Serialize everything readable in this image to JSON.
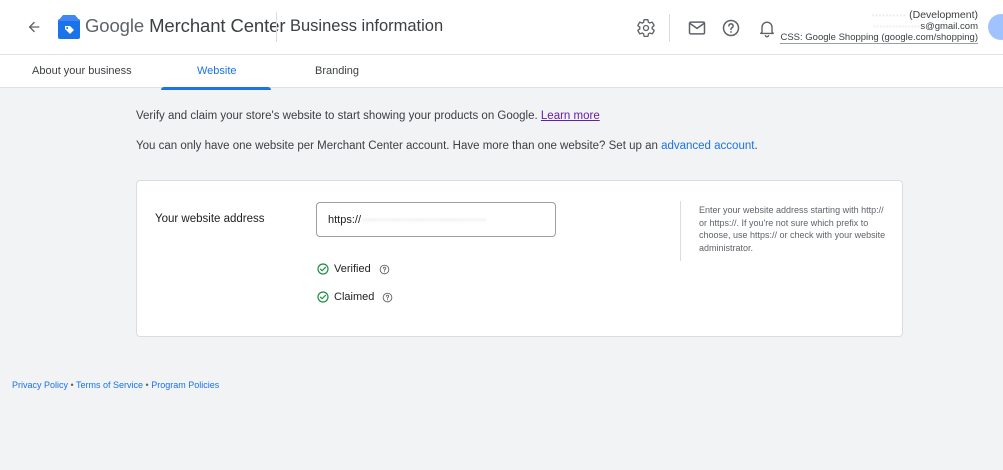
{
  "header": {
    "brand_google": "Google",
    "brand_product": " Merchant Center",
    "page_title": "Business information",
    "account": {
      "name_hidden": "··········",
      "name_suffix": " (Development)",
      "email_hidden": "···············",
      "email_suffix": "s@gmail.com",
      "css": "CSS: Google Shopping (google.com/shopping)"
    },
    "icons": [
      "back-arrow-icon",
      "merchant-center-logo",
      "settings-icon",
      "mail-icon",
      "help-icon",
      "notifications-icon",
      "avatar"
    ]
  },
  "tabs": [
    {
      "label": "About your business",
      "active": false
    },
    {
      "label": "Website",
      "active": true
    },
    {
      "label": "Branding",
      "active": false
    }
  ],
  "intro": {
    "line1": "Verify and claim your store's website to start showing your products on Google.",
    "learn_more": "Learn more",
    "line2": "You can only have one website per Merchant Center account. Have more than one website? Set up an",
    "advanced_link": "advanced account",
    "line2_end": "."
  },
  "website": {
    "label": "Your website address",
    "url_prefix": "https://",
    "url_hidden": "··································",
    "statuses": [
      {
        "label": "Verified",
        "color": "#1e8e3e"
      },
      {
        "label": "Claimed",
        "color": "#1e8e3e"
      }
    ],
    "hint": "Enter your website address starting with http:// or https://. If you're not sure which prefix to choose, use https:// or check with your website administrator."
  },
  "footer": {
    "links": [
      "Privacy Policy",
      "Terms of Service",
      "Program Policies"
    ],
    "separator": " • "
  },
  "colors": {
    "accent": "#1a73e8",
    "success": "#1e8e3e",
    "link_visited": "#681da8"
  }
}
